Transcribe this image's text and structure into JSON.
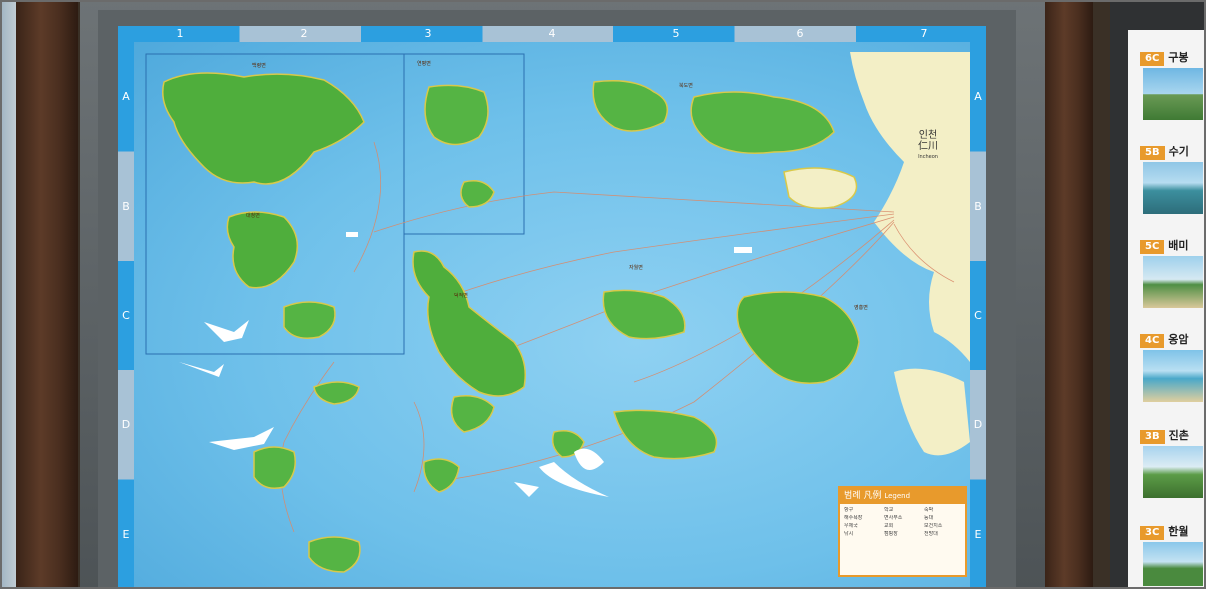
{
  "map": {
    "top_numbers": [
      "1",
      "2",
      "3",
      "4",
      "5",
      "6",
      "7"
    ],
    "row_letters": [
      "A",
      "B",
      "C",
      "D",
      "E"
    ],
    "region_labels": [
      "백령면",
      "대청면",
      "연평면",
      "덕적면",
      "자월면",
      "영흥면",
      "북도면"
    ],
    "city_ko": "인천",
    "city_hanja": "仁川",
    "city_en": "Incheon",
    "legend": {
      "title_ko": "범례",
      "title_hanja": "凡例",
      "title_en": "Legend",
      "items": [
        "항구",
        "학교",
        "숙박",
        "해수욕장",
        "면사무소",
        "등대",
        "우체국",
        "교회",
        "보건지소",
        "낚시",
        "캠핑장",
        "전망대"
      ]
    }
  },
  "key_attractions": {
    "items": [
      {
        "code": "6C",
        "title": "구봉"
      },
      {
        "code": "5B",
        "title": "수기"
      },
      {
        "code": "5C",
        "title": "배미"
      },
      {
        "code": "4C",
        "title": "옹암"
      },
      {
        "code": "3B",
        "title": "진촌"
      },
      {
        "code": "3C",
        "title": "한월"
      }
    ]
  }
}
